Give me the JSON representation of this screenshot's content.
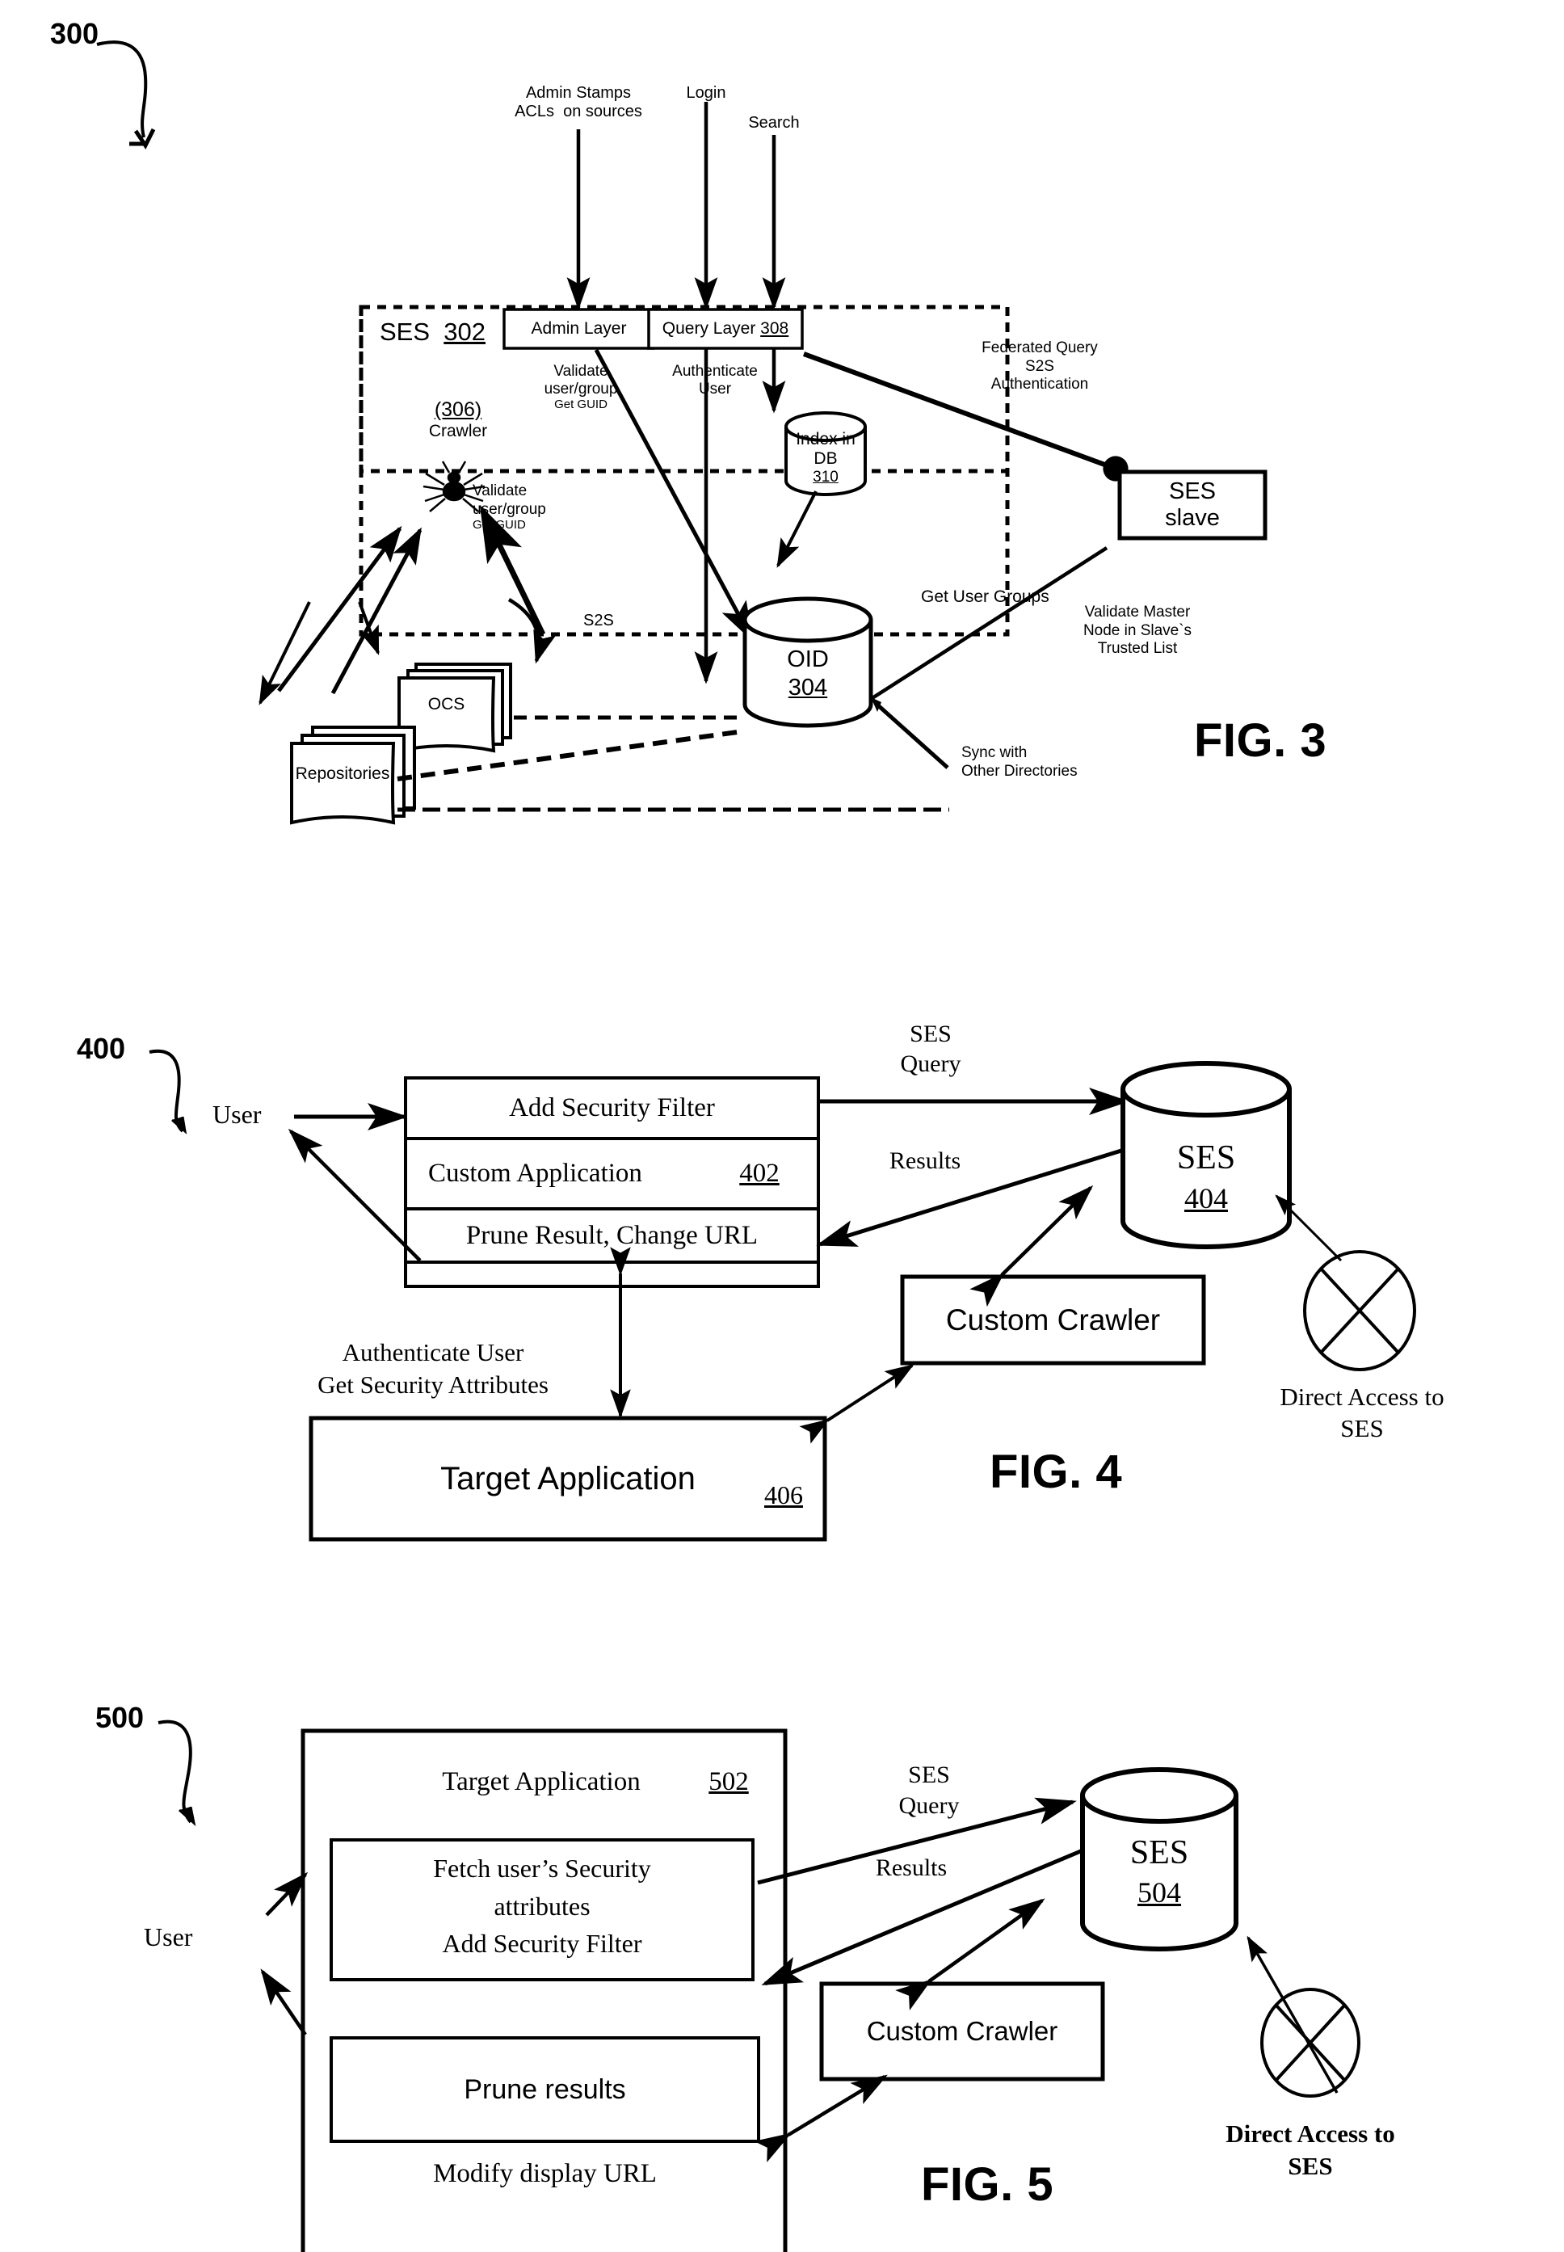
{
  "document": {
    "type": "patent-drawing-sheet",
    "figures": [
      "FIG. 3",
      "FIG. 4",
      "FIG. 5"
    ]
  },
  "fig3": {
    "caption": "FIG. 3",
    "ref_number": "300",
    "boundary_label": "SES",
    "boundary_ref": "302",
    "inputs": [
      {
        "name": "admin-stamps-input",
        "line1": "Admin Stamps",
        "line2": "ACLs  on sources"
      },
      {
        "name": "login-input",
        "line1": "Login",
        "line2": ""
      },
      {
        "name": "search-input",
        "line1": "Search",
        "line2": ""
      }
    ],
    "admin_layer": {
      "label": "Admin Layer"
    },
    "query_layer": {
      "label": "Query Layer",
      "ref": "308"
    },
    "crawler": {
      "ref": "(306)",
      "label": "Crawler"
    },
    "index_db": {
      "line1": "Index in",
      "line2": "DB",
      "ref": "310"
    },
    "oid": {
      "label": "OID",
      "ref": "304"
    },
    "ses_slave": {
      "line1": "SES",
      "line2": "slave"
    },
    "ocs": {
      "label": "OCS"
    },
    "repositories": {
      "label": "Repositories"
    },
    "annotations": {
      "validate_admin": {
        "line1": "Validate",
        "line2": "user/group",
        "line3": "Get GUID"
      },
      "authenticate_user": {
        "line1": "Authenticate",
        "line2": "User"
      },
      "validate_crawler": {
        "line1": "Validate",
        "line2": "user/group",
        "line3": "Get GUID"
      },
      "federated_query": {
        "line1": "Federated Query",
        "line2": "S2S",
        "line3": "Authentication"
      },
      "validate_master": {
        "line1": "Validate Master",
        "line2": "Node in Slave`s",
        "line3": "Trusted List"
      },
      "get_user_groups": {
        "line1": "Get User Groups"
      },
      "sync_with": {
        "line1": "Sync with",
        "line2": "Other Directories"
      },
      "s2s": {
        "line1": "S2S"
      }
    }
  },
  "fig4": {
    "caption": "FIG. 4",
    "ref_number": "400",
    "user_label": "User",
    "custom_app": {
      "row1": "Add Security Filter",
      "row2_label": "Custom Application",
      "row2_ref": "402",
      "row3": "Prune Result, Change URL"
    },
    "ses": {
      "label": "SES",
      "ref": "404"
    },
    "custom_crawler": {
      "label": "Custom Crawler"
    },
    "target_app": {
      "label": "Target Application",
      "ref": "406"
    },
    "annotations": {
      "ses_query": {
        "line1": "SES",
        "line2": "Query"
      },
      "results": {
        "line1": "Results"
      },
      "authenticate": {
        "line1": "Authenticate User",
        "line2": "Get Security Attributes"
      },
      "direct_access": {
        "line1": "Direct Access to",
        "line2": "SES"
      }
    }
  },
  "fig5": {
    "caption": "FIG. 5",
    "ref_number": "500",
    "user_label": "User",
    "target_app": {
      "title": "Target Application",
      "ref": "502",
      "inner1_line1": "Fetch user’s Security",
      "inner1_line2": "attributes",
      "inner1_line3": "Add Security Filter",
      "inner2": "Prune results",
      "footer": "Modify display URL"
    },
    "ses": {
      "label": "SES",
      "ref": "504"
    },
    "custom_crawler": {
      "label": "Custom Crawler"
    },
    "annotations": {
      "ses_query": {
        "line1": "SES",
        "line2": "Query"
      },
      "results": {
        "line1": "Results"
      },
      "direct_access": {
        "line1": "Direct Access to",
        "line2": "SES"
      }
    }
  }
}
